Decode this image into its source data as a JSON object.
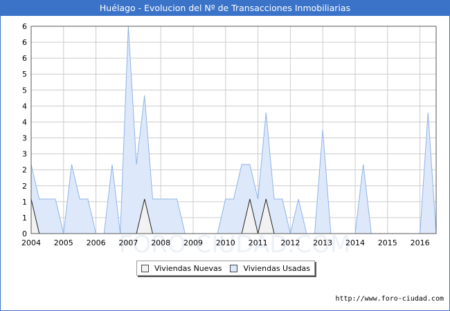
{
  "title": "Huélago - Evolucion del Nº de Transacciones Inmobiliarias",
  "source_url": "http://www.foro-ciudad.com",
  "watermark": "FORO-CIUDAD.COM",
  "colors": {
    "header": "#3b73c9",
    "nuevas_fill": "#f2f2f2",
    "nuevas_line": "#222222",
    "usadas_fill": "#dde9fb",
    "usadas_line": "#8fb3e6",
    "grid": "#cccccc"
  },
  "chart_data": {
    "type": "area",
    "title": "Huélago - Evolucion del Nº de Transacciones Inmobiliarias",
    "xlabel": "",
    "ylabel": "",
    "ylim": [
      0,
      6
    ],
    "xlim": [
      2004,
      2016.5
    ],
    "y_tick_labels": [
      "0",
      "1",
      "1",
      "2",
      "2",
      "3",
      "3",
      "4",
      "4",
      "5",
      "5",
      "6",
      "6",
      "6"
    ],
    "x_tick_labels": [
      "2004",
      "2005",
      "2006",
      "2007",
      "2008",
      "2009",
      "2010",
      "2011",
      "2012",
      "2013",
      "2014",
      "2015",
      "2016"
    ],
    "grid": true,
    "legend_position": "bottom-center",
    "series": [
      {
        "name": "Viviendas Nuevas",
        "x": [
          2004,
          2004.25,
          2004.5,
          2004.75,
          2005,
          2005.25,
          2005.5,
          2005.75,
          2006,
          2006.25,
          2006.5,
          2006.75,
          2007,
          2007.25,
          2007.5,
          2007.75,
          2008,
          2008.25,
          2008.5,
          2008.75,
          2009,
          2009.25,
          2009.5,
          2009.75,
          2010,
          2010.25,
          2010.5,
          2010.75,
          2011,
          2011.25,
          2011.5,
          2011.75,
          2012,
          2012.25,
          2012.5,
          2012.75,
          2013,
          2013.25,
          2013.5,
          2013.75,
          2014,
          2014.25,
          2014.5,
          2014.75,
          2015,
          2015.25,
          2015.5,
          2015.75,
          2016,
          2016.25,
          2016.5
        ],
        "values": [
          1,
          0,
          0,
          0,
          0,
          0,
          0,
          0,
          0,
          0,
          0,
          0,
          0,
          0,
          1,
          0,
          0,
          0,
          0,
          0,
          0,
          0,
          0,
          0,
          0,
          0,
          0,
          1,
          0,
          1,
          0,
          0,
          0,
          0,
          0,
          0,
          0,
          0,
          0,
          0,
          0,
          0,
          0,
          0,
          0,
          0,
          0,
          0,
          0,
          0,
          0
        ]
      },
      {
        "name": "Viviendas Usadas",
        "x": [
          2004,
          2004.25,
          2004.5,
          2004.75,
          2005,
          2005.25,
          2005.5,
          2005.75,
          2006,
          2006.25,
          2006.5,
          2006.75,
          2007,
          2007.25,
          2007.5,
          2007.75,
          2008,
          2008.25,
          2008.5,
          2008.75,
          2009,
          2009.25,
          2009.5,
          2009.75,
          2010,
          2010.25,
          2010.5,
          2010.75,
          2011,
          2011.25,
          2011.5,
          2011.75,
          2012,
          2012.25,
          2012.5,
          2012.75,
          2013,
          2013.25,
          2013.5,
          2013.75,
          2014,
          2014.25,
          2014.5,
          2014.75,
          2015,
          2015.25,
          2015.5,
          2015.75,
          2016,
          2016.25,
          2016.5
        ],
        "values": [
          2,
          1,
          1,
          1,
          0,
          2,
          1,
          1,
          0,
          0,
          2,
          0,
          6,
          2,
          4,
          1,
          1,
          1,
          1,
          0,
          0,
          0,
          0,
          0,
          1,
          1,
          2,
          2,
          1,
          3.5,
          1,
          1,
          0,
          1,
          0,
          0,
          3,
          0,
          0,
          0,
          0,
          2,
          0,
          0,
          0,
          0,
          0,
          0,
          0,
          3.5,
          0
        ]
      }
    ]
  }
}
